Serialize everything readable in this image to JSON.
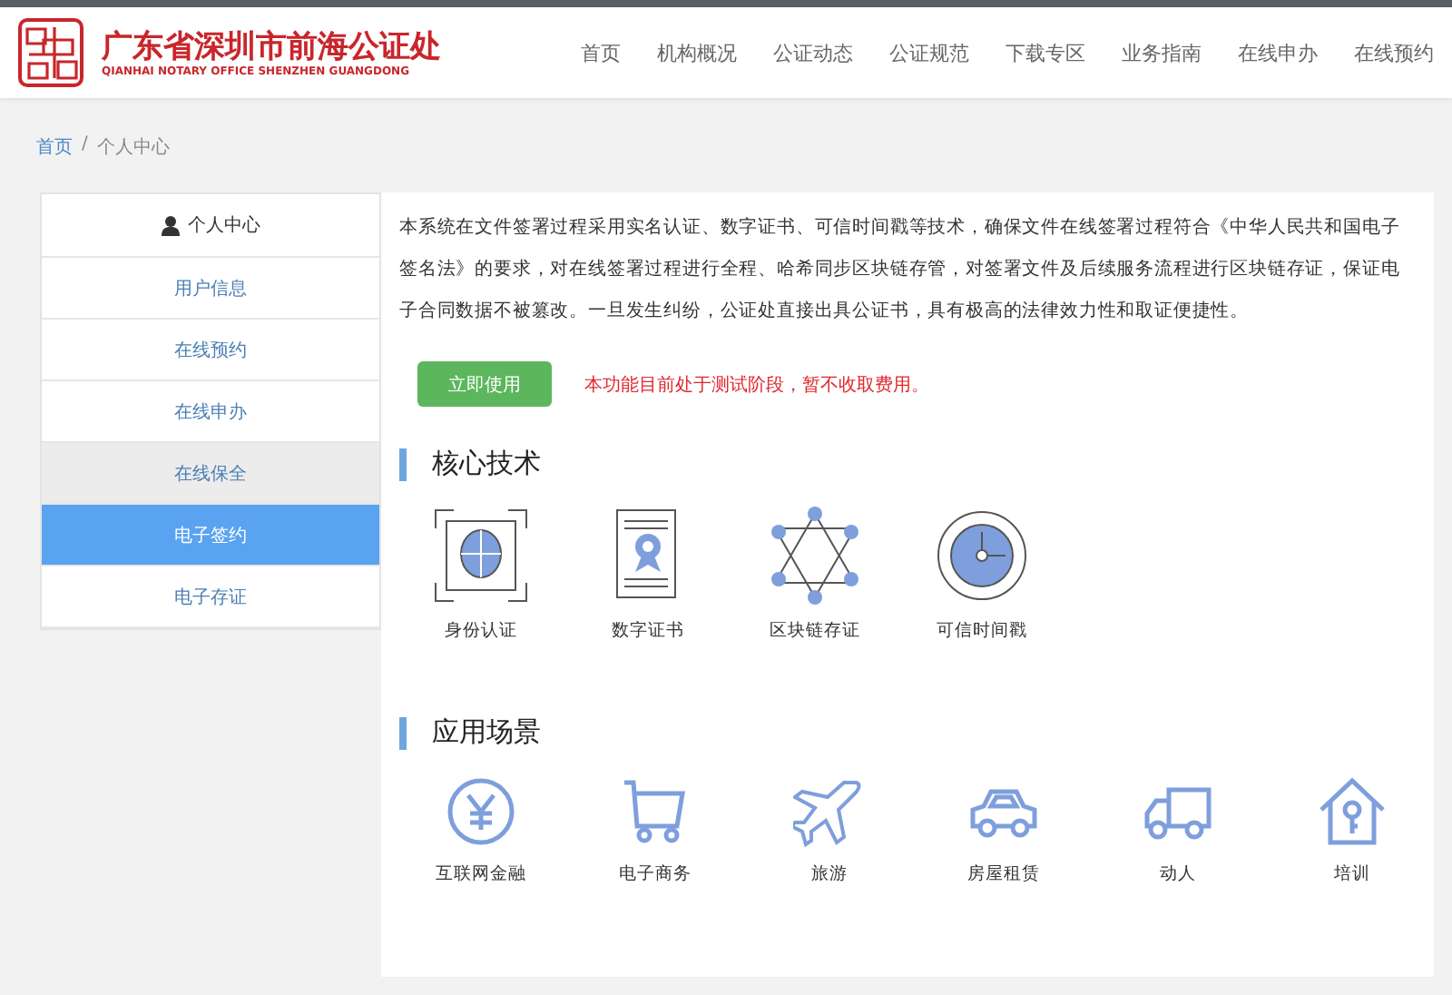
{
  "header": {
    "logo_title": "广东省深圳市前海公证处",
    "logo_subtitle": "QIANHAI NOTARY OFFICE SHENZHEN GUANGDONG",
    "nav": [
      "首页",
      "机构概况",
      "公证动态",
      "公证规范",
      "下载专区",
      "业务指南",
      "在线申办",
      "在线预约"
    ]
  },
  "breadcrumb": {
    "separator": "/",
    "items": [
      {
        "label": "首页",
        "link": true
      },
      {
        "label": "个人中心",
        "link": false
      }
    ]
  },
  "sidebar": {
    "title": "个人中心",
    "items": [
      {
        "label": "用户信息",
        "selected": false,
        "hover": false
      },
      {
        "label": "在线预约",
        "selected": false,
        "hover": false
      },
      {
        "label": "在线申办",
        "selected": false,
        "hover": false
      },
      {
        "label": "在线保全",
        "selected": false,
        "hover": true
      },
      {
        "label": "电子签约",
        "selected": true,
        "hover": false
      },
      {
        "label": "电子存证",
        "selected": false,
        "hover": false
      }
    ]
  },
  "intro": "本系统在文件签署过程采用实名认证、数字证书、可信时间戳等技术，确保文件在线签署过程符合《中华人民共和国电子签名法》的要求，对在线签署过程进行全程、哈希同步区块链存管，对签署文件及后续服务流程进行区块链存证，保证电子合同数据不被篡改。一旦发生纠纷，公证处直接出具公证书，具有极高的法律效力性和取证便捷性。",
  "use_button": "立即使用",
  "notice": "本功能目前处于测试阶段，暂不收取费用。",
  "core_tech": {
    "heading": "核心技术",
    "items": [
      {
        "kind": "face",
        "label": "身份认证"
      },
      {
        "kind": "certificate",
        "label": "数字证书"
      },
      {
        "kind": "blockchain",
        "label": "区块链存证"
      },
      {
        "kind": "clock",
        "label": "可信时间戳"
      }
    ]
  },
  "scenarios": {
    "heading": "应用场景",
    "items": [
      {
        "kind": "yen",
        "label": "互联网金融"
      },
      {
        "kind": "cart",
        "label": "电子商务"
      },
      {
        "kind": "plane",
        "label": "旅游"
      },
      {
        "kind": "car",
        "label": "房屋租赁"
      },
      {
        "kind": "truck",
        "label": "动人"
      },
      {
        "kind": "house",
        "label": "培训"
      }
    ]
  }
}
